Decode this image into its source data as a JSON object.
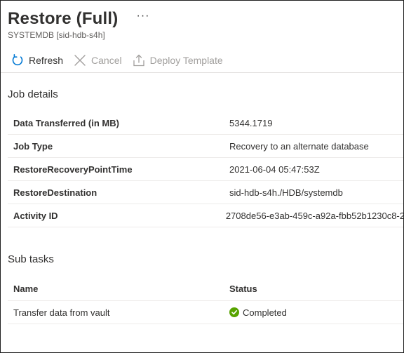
{
  "header": {
    "title": "Restore (Full)",
    "more_label": "···",
    "subtitle": "SYSTEMDB [sid-hdb-s4h]"
  },
  "toolbar": {
    "refresh_label": "Refresh",
    "cancel_label": "Cancel",
    "deploy_label": "Deploy Template"
  },
  "job_details": {
    "title": "Job details",
    "rows": [
      {
        "key": "Data Transferred (in MB)",
        "value": "5344.1719"
      },
      {
        "key": "Job Type",
        "value": "Recovery to an alternate database"
      },
      {
        "key": "RestoreRecoveryPointTime",
        "value": "2021-06-04 05:47:53Z"
      },
      {
        "key": "RestoreDestination",
        "value": "sid-hdb-s4h./HDB/systemdb"
      },
      {
        "key": "Activity ID",
        "value": "2708de56-e3ab-459c-a92a-fbb52b1230c8-2"
      }
    ]
  },
  "sub_tasks": {
    "title": "Sub tasks",
    "columns": [
      "Name",
      "Status"
    ],
    "rows": [
      {
        "name": "Transfer data from vault",
        "status": "Completed"
      }
    ]
  },
  "colors": {
    "accent": "#0078d4",
    "success": "#57a300",
    "disabled": "#a19f9d"
  },
  "icons": {
    "refresh": "refresh-icon",
    "cancel": "cancel-icon",
    "deploy": "upload-icon",
    "status": "check-circle-icon"
  }
}
